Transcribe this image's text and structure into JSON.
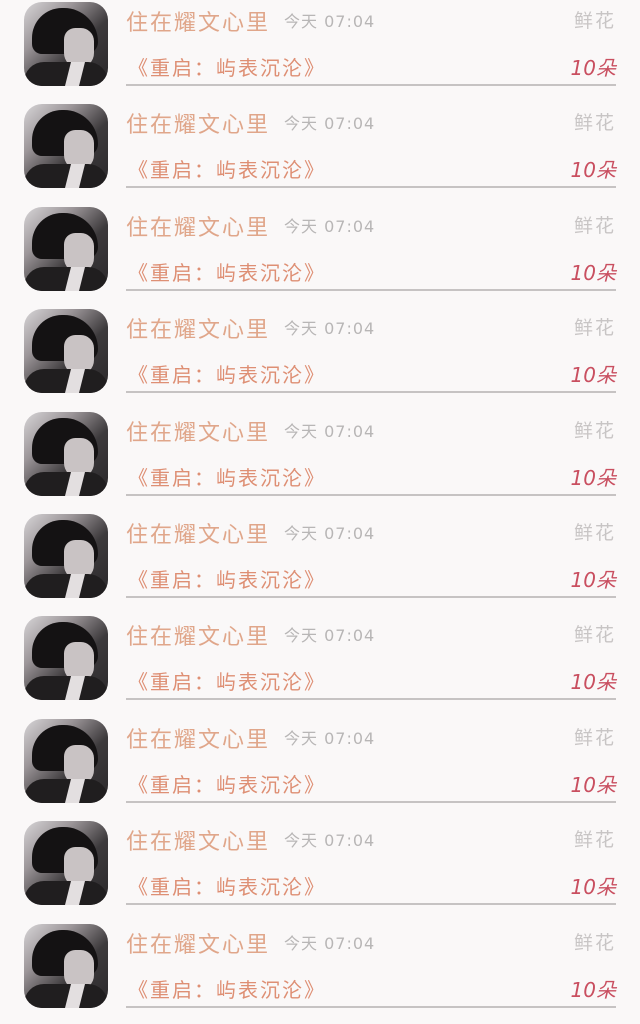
{
  "messages": [
    {
      "sender": "住在耀文心里",
      "time": "今天 07:04",
      "gift_type": "鲜花",
      "message": "《重启：屿表沉沦》",
      "count": "10朵"
    },
    {
      "sender": "住在耀文心里",
      "time": "今天 07:04",
      "gift_type": "鲜花",
      "message": "《重启：屿表沉沦》",
      "count": "10朵"
    },
    {
      "sender": "住在耀文心里",
      "time": "今天 07:04",
      "gift_type": "鲜花",
      "message": "《重启：屿表沉沦》",
      "count": "10朵"
    },
    {
      "sender": "住在耀文心里",
      "time": "今天 07:04",
      "gift_type": "鲜花",
      "message": "《重启：屿表沉沦》",
      "count": "10朵"
    },
    {
      "sender": "住在耀文心里",
      "time": "今天 07:04",
      "gift_type": "鲜花",
      "message": "《重启：屿表沉沦》",
      "count": "10朵"
    },
    {
      "sender": "住在耀文心里",
      "time": "今天 07:04",
      "gift_type": "鲜花",
      "message": "《重启：屿表沉沦》",
      "count": "10朵"
    },
    {
      "sender": "住在耀文心里",
      "time": "今天 07:04",
      "gift_type": "鲜花",
      "message": "《重启：屿表沉沦》",
      "count": "10朵"
    },
    {
      "sender": "住在耀文心里",
      "time": "今天 07:04",
      "gift_type": "鲜花",
      "message": "《重启：屿表沉沦》",
      "count": "10朵"
    },
    {
      "sender": "住在耀文心里",
      "time": "今天 07:04",
      "gift_type": "鲜花",
      "message": "《重启：屿表沉沦》",
      "count": "10朵"
    },
    {
      "sender": "住在耀文心里",
      "time": "今天 07:04",
      "gift_type": "鲜花",
      "message": "《重启：屿表沉沦》",
      "count": "10朵"
    }
  ]
}
